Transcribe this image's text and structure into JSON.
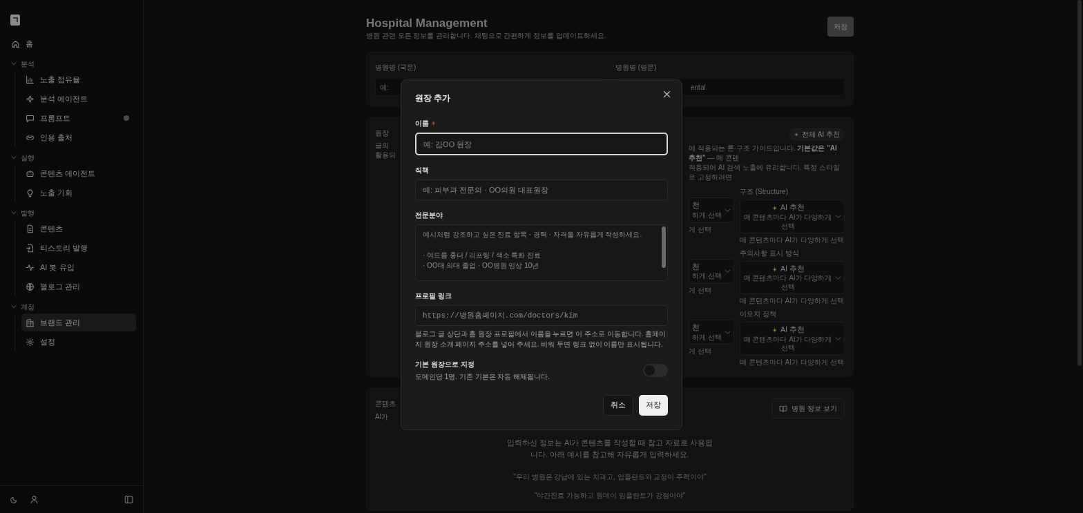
{
  "sidebar": {
    "home": {
      "label": "홈",
      "selected": false
    },
    "sections": [
      {
        "title": "분석",
        "expanded": true,
        "items": [
          {
            "label": "노출 점유율",
            "selected": false,
            "indicator": false
          },
          {
            "label": "분석 에이전트",
            "selected": false,
            "indicator": false
          },
          {
            "label": "프롬프트",
            "selected": false,
            "indicator": true
          },
          {
            "label": "인용 출처",
            "selected": false,
            "indicator": false
          }
        ]
      },
      {
        "title": "실행",
        "expanded": true,
        "items": [
          {
            "label": "콘텐츠 에이전트",
            "selected": false,
            "indicator": false
          },
          {
            "label": "노출 기회",
            "selected": false,
            "indicator": false
          }
        ]
      },
      {
        "title": "발행",
        "expanded": true,
        "items": [
          {
            "label": "콘텐츠",
            "selected": false,
            "indicator": false
          },
          {
            "label": "티스토리 발행",
            "selected": false,
            "indicator": false
          },
          {
            "label": "AI 봇 유입",
            "selected": false,
            "indicator": false
          },
          {
            "label": "블로그 관리",
            "selected": false,
            "indicator": false
          }
        ]
      },
      {
        "title": "계정",
        "expanded": true,
        "items": [
          {
            "label": "브랜드 관리",
            "selected": true,
            "indicator": false
          },
          {
            "label": "설정",
            "selected": false,
            "indicator": false
          }
        ]
      }
    ]
  },
  "page": {
    "title": "Hospital Management",
    "subtitle": "병원 관련 모든 정보를 관리합니다. 채팅으로 간편하게 정보를 업데이트하세요.",
    "save_button": "저장"
  },
  "hospital_card": {
    "fields": [
      {
        "label": "병원명 (국문)",
        "placeholder": "예:"
      },
      {
        "label": "병원명 (영문)",
        "placeholder": "ental"
      }
    ]
  },
  "director_card": {
    "title": "원장",
    "description_left": [
      "글의",
      "활용되"
    ],
    "description_right": [
      "에 적용되는 톤·구조 가이드입니다. **기본값은 \"AI 추천\"** — 매 콘텐",
      "적용되어 AI 검색 노출에 유리합니다. 특정 스타일로 고정하려면"
    ],
    "ai_button": "전체 AI 추천",
    "style_rows": [
      {
        "partial_value": "천",
        "partial_sub": "하게 선택",
        "partial_helper": "게 선택",
        "label": "구조 (Structure)",
        "value": "AI 추천",
        "sub": "매 콘텐츠마다 AI가 다양하게 선택",
        "helper": "매 콘텐츠마다 AI가 다양하게 선택"
      },
      {
        "partial_value": "천",
        "partial_sub": "하게 선택",
        "partial_helper": "게 선택",
        "label": "주의사항 표시 방식",
        "value": "AI 추천",
        "sub": "매 콘텐츠마다 AI가 다양하게 선택",
        "helper": "매 콘텐츠마다 AI가 다양하게 선택"
      },
      {
        "partial_value": "천",
        "partial_sub": "하게 선택",
        "partial_helper": "게 선택",
        "label": "이모지 정책",
        "value": "AI 추천",
        "sub": "매 콘텐츠마다 AI가 다양하게 선택",
        "helper": "매 콘텐츠마다 AI가 다양하게 선택"
      }
    ]
  },
  "content_card": {
    "title": "콘텐츠",
    "subtitle": "AI가",
    "view_button": "병원 정보 보기",
    "intro": "입력하신 정보는 AI가 콘텐츠를 작성할 때 참고 자료로 사용됩니다. 아래 예시를 참고해 자유롭게 입력하세요.",
    "examples": [
      "\"우리 병원은 강남에 있는 치과고, 임플란트와 교정이 주력이야\"",
      "\"야간진료 가능하고 원데이 임플란트가 강점이야\""
    ]
  },
  "dialog": {
    "title": "원장 추가",
    "fields": [
      {
        "kind": "input",
        "label": "이름",
        "required": true,
        "focused": true,
        "placeholder": "예: 김OO 원장"
      },
      {
        "kind": "input",
        "label": "직책",
        "required": false,
        "focused": false,
        "placeholder": "예: 피부과 전문의 · OO의원 대표원장"
      },
      {
        "kind": "textarea",
        "label": "전문분야",
        "required": false,
        "focused": false,
        "placeholder": "예시처럼 강조하고 싶은 진료 항목 · 경력 · 자격을 자유롭게 작성하세요.\n\n· 여드름 흉터 / 리프팅 / 색소 특화 진료\n· OO대 의대 졸업 · OO병원 임상 10년"
      },
      {
        "kind": "url",
        "label": "프로필 링크",
        "required": false,
        "focused": false,
        "placeholder": "https://병원홈페이지.com/doctors/kim",
        "help": "블로그 글 상단과 홈 원장 프로필에서 이름을 누르면 이 주소로 이동합니다. 홈페이지 원장 소개 페이지 주소를 넣어 주세요. 비워 두면 링크 없이 이름만 표시됩니다."
      }
    ],
    "default_toggle": {
      "label": "기본 원장으로 지정",
      "description": "도메인당 1명. 기존 기본은 자동 해제됩니다.",
      "on": false
    },
    "cancel_button": "취소",
    "save_button": "저장"
  }
}
